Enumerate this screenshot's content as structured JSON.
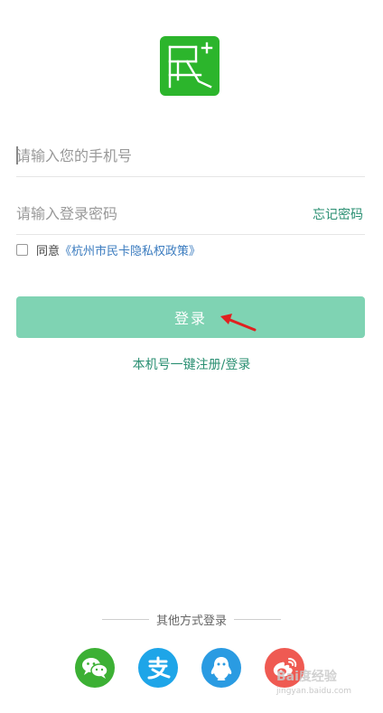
{
  "logo": {
    "icon": "app-logo-icon",
    "color": "#2cb52c"
  },
  "phone": {
    "placeholder": "请输入您的手机号",
    "value": ""
  },
  "password": {
    "placeholder": "请输入登录密码",
    "value": "",
    "forgot_label": "忘记密码"
  },
  "agreement": {
    "checked": false,
    "prefix": "同意",
    "policy_link": "《杭州市民卡隐私权政策》"
  },
  "login": {
    "label": "登录",
    "color": "#7fd3b3"
  },
  "onekey_register": {
    "label": "本机号一键注册/登录"
  },
  "other_login": {
    "title": "其他方式登录",
    "providers": [
      {
        "icon": "wechat-icon",
        "color": "#3cb034"
      },
      {
        "icon": "alipay-icon",
        "color": "#1ea5e8"
      },
      {
        "icon": "qq-icon",
        "color": "#2a9be2"
      },
      {
        "icon": "weibo-icon",
        "color": "#ef5a52"
      }
    ]
  },
  "watermark": {
    "text": "Bai度经验",
    "sub": "jingyan.baidu.com"
  },
  "accent_color": "#2a8f72"
}
